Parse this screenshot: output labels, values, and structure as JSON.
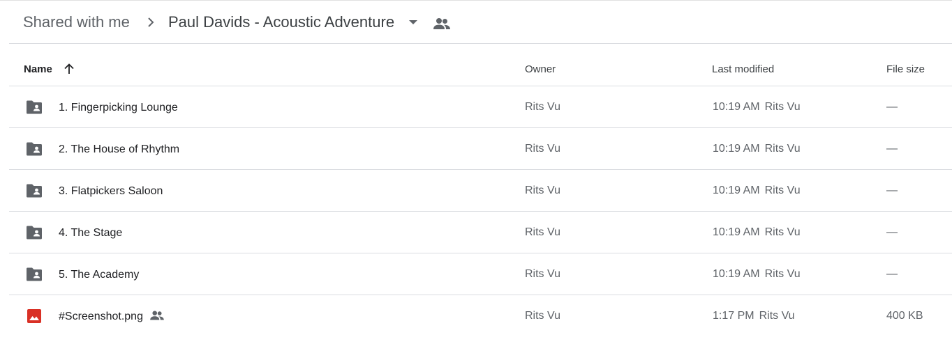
{
  "breadcrumb": {
    "root": "Shared with me",
    "separator_icon": "chevron-right-icon",
    "current": "Paul Davids - Acoustic Adventure",
    "caret_icon": "caret-down-icon",
    "shared_icon": "people-icon"
  },
  "columns": {
    "name": "Name",
    "sort_icon": "arrow-up-icon",
    "owner": "Owner",
    "last_modified": "Last modified",
    "file_size": "File size"
  },
  "files": [
    {
      "name": "1. Fingerpicking Lounge",
      "type": "shared-folder",
      "owner": "Rits Vu",
      "modified_time": "10:19 AM",
      "modified_by": "Rits Vu",
      "size": "—"
    },
    {
      "name": "2. The House of Rhythm",
      "type": "shared-folder",
      "owner": "Rits Vu",
      "modified_time": "10:19 AM",
      "modified_by": "Rits Vu",
      "size": "—"
    },
    {
      "name": "3. Flatpickers Saloon",
      "type": "shared-folder",
      "owner": "Rits Vu",
      "modified_time": "10:19 AM",
      "modified_by": "Rits Vu",
      "size": "—"
    },
    {
      "name": "4. The Stage",
      "type": "shared-folder",
      "owner": "Rits Vu",
      "modified_time": "10:19 AM",
      "modified_by": "Rits Vu",
      "size": "—"
    },
    {
      "name": "5. The Academy",
      "type": "shared-folder",
      "owner": "Rits Vu",
      "modified_time": "10:19 AM",
      "modified_by": "Rits Vu",
      "size": "—"
    },
    {
      "name": "#Screenshot.png",
      "type": "image",
      "shared": true,
      "owner": "Rits Vu",
      "modified_time": "1:17 PM",
      "modified_by": "Rits Vu",
      "size": "400 KB"
    }
  ],
  "colors": {
    "folder_icon": "#5f6368",
    "image_icon": "#d93025",
    "divider": "#dadce0",
    "text_primary": "#202124",
    "text_secondary": "#5f6368"
  }
}
